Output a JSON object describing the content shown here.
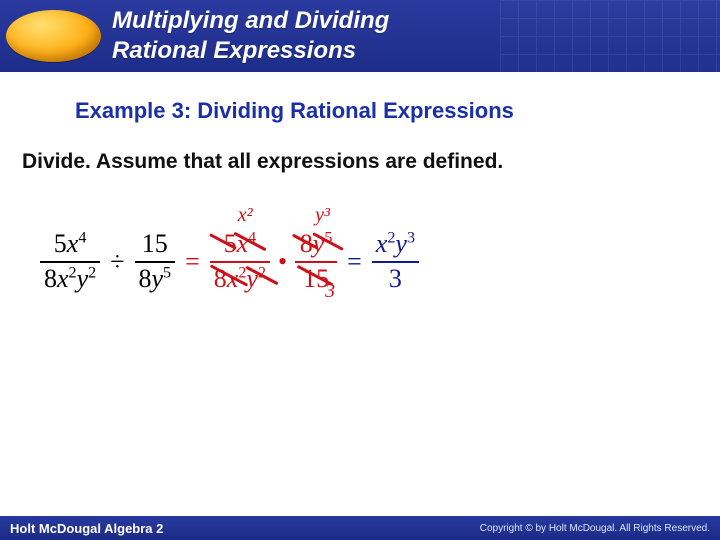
{
  "header": {
    "title_line1": "Multiplying and Dividing",
    "title_line2": "Rational Expressions"
  },
  "example_heading": "Example 3: Dividing Rational Expressions",
  "instruction": "Divide. Assume that all expressions are defined.",
  "math": {
    "lhs_frac1": {
      "num": "5x⁴",
      "den": "8x²y²"
    },
    "divide_symbol": "÷",
    "lhs_frac2": {
      "num": "15",
      "den": "8y⁵"
    },
    "equals": "=",
    "step_frac1": {
      "num": "5x⁴",
      "den": "8x²y²"
    },
    "dot": "•",
    "step_frac2": {
      "num": "8y⁵",
      "den": "15"
    },
    "result_frac": {
      "num": "x²y³",
      "den": "3"
    },
    "annotations": {
      "top1": "x²",
      "top2": "y³",
      "bottom": "3"
    }
  },
  "footer": {
    "left": "Holt McDougal Algebra 2",
    "right": "Copyright © by Holt McDougal. All Rights Reserved."
  },
  "chart_data": {
    "type": "table",
    "title": "Worked example: dividing rational expressions",
    "expression": "(5x^4)/(8x^2 y^2) ÷ 15/(8y^5)",
    "rewritten": "(5x^4)/(8x^2 y^2) · (8y^5)/15",
    "cancellations": [
      "5 and 15 → leaves 3 in denominator",
      "x^4 and x^2 → leaves x^2 in numerator",
      "y^5 and y^2 → leaves y^3 in numerator",
      "8 and 8 cancel"
    ],
    "result": "(x^2 y^3)/3"
  }
}
